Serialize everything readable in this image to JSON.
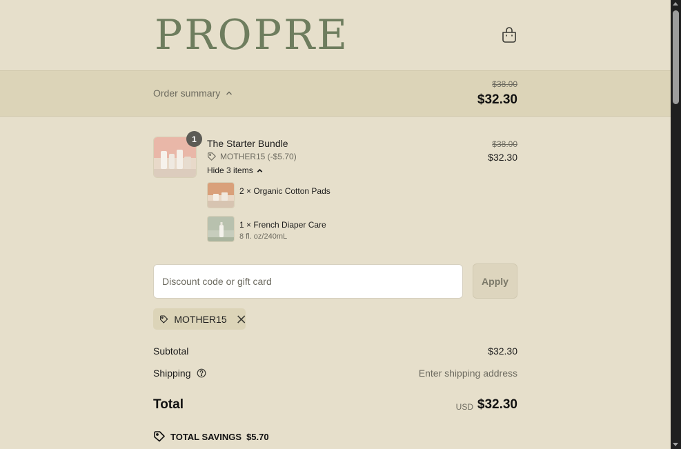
{
  "header": {
    "logo_text": "PROPRE",
    "cart_icon": "shopping-bag-icon"
  },
  "summary": {
    "toggle_label": "Order summary",
    "original_price": "$38.00",
    "total_price": "$32.30"
  },
  "product": {
    "quantity": "1",
    "name": "The Starter Bundle",
    "discount": "MOTHER15 (-$5.70)",
    "original_price": "$38.00",
    "price": "$32.30",
    "toggle_label": "Hide 3 items",
    "items": [
      {
        "label": "2 × Organic Cotton Pads",
        "meta": ""
      },
      {
        "label": "1 × French Diaper Care",
        "meta": "8 fl. oz/240mL"
      }
    ]
  },
  "discount": {
    "placeholder": "Discount code or gift card",
    "value": "",
    "apply_label": "Apply",
    "applied_code": "MOTHER15"
  },
  "totals": {
    "subtotal_label": "Subtotal",
    "subtotal_value": "$32.30",
    "shipping_label": "Shipping",
    "shipping_value": "Enter shipping address",
    "total_label": "Total",
    "currency": "USD",
    "total_value": "$32.30",
    "savings_label": "TOTAL SAVINGS",
    "savings_value": "$5.70"
  },
  "colors": {
    "background": "#e6dfcb",
    "summary_bar": "#dcd4b8",
    "logo": "#6e7d5e",
    "badge": "#5c5b55"
  }
}
